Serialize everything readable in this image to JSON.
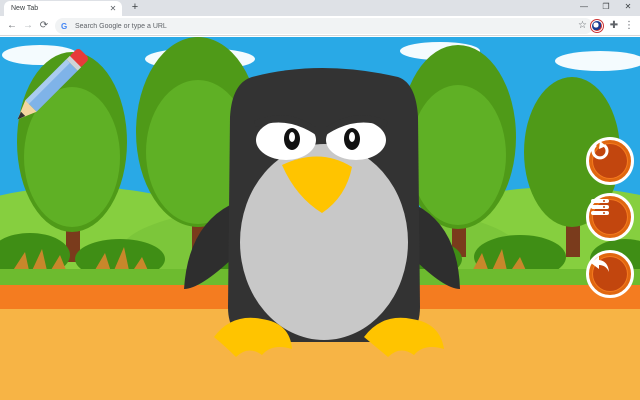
{
  "browser": {
    "tab_title": "New Tab",
    "tab_close": "✕",
    "new_tab": "+",
    "window_controls": [
      "—",
      "❐",
      "✕"
    ],
    "omnibox_placeholder": "Search Google or type a URL",
    "nav_glyphs": {
      "back": "←",
      "forward": "→",
      "reload": "⟳"
    },
    "icons": [
      "google-g-icon",
      "star-icon",
      "flag-extension-icon",
      "puzzle-extension-icon",
      "kebab-menu-icon"
    ]
  },
  "game": {
    "character": "penguin",
    "tool": "pencil-icon",
    "buttons": [
      {
        "name": "restart-button",
        "icon": "restart-icon"
      },
      {
        "name": "menu-button",
        "icon": "list-menu-icon"
      },
      {
        "name": "back-button",
        "icon": "back-arrow-icon"
      }
    ],
    "colors": {
      "sky": "#29a9e6",
      "tree_green": "#55a11b",
      "grass": "#7ac943",
      "ground_orange": "#f47c20",
      "sand": "#f7b445",
      "penguin_body": "#333333",
      "penguin_belly": "#c8c8c8",
      "beak": "#ffc400",
      "button_orange": "#f47a1f"
    }
  }
}
